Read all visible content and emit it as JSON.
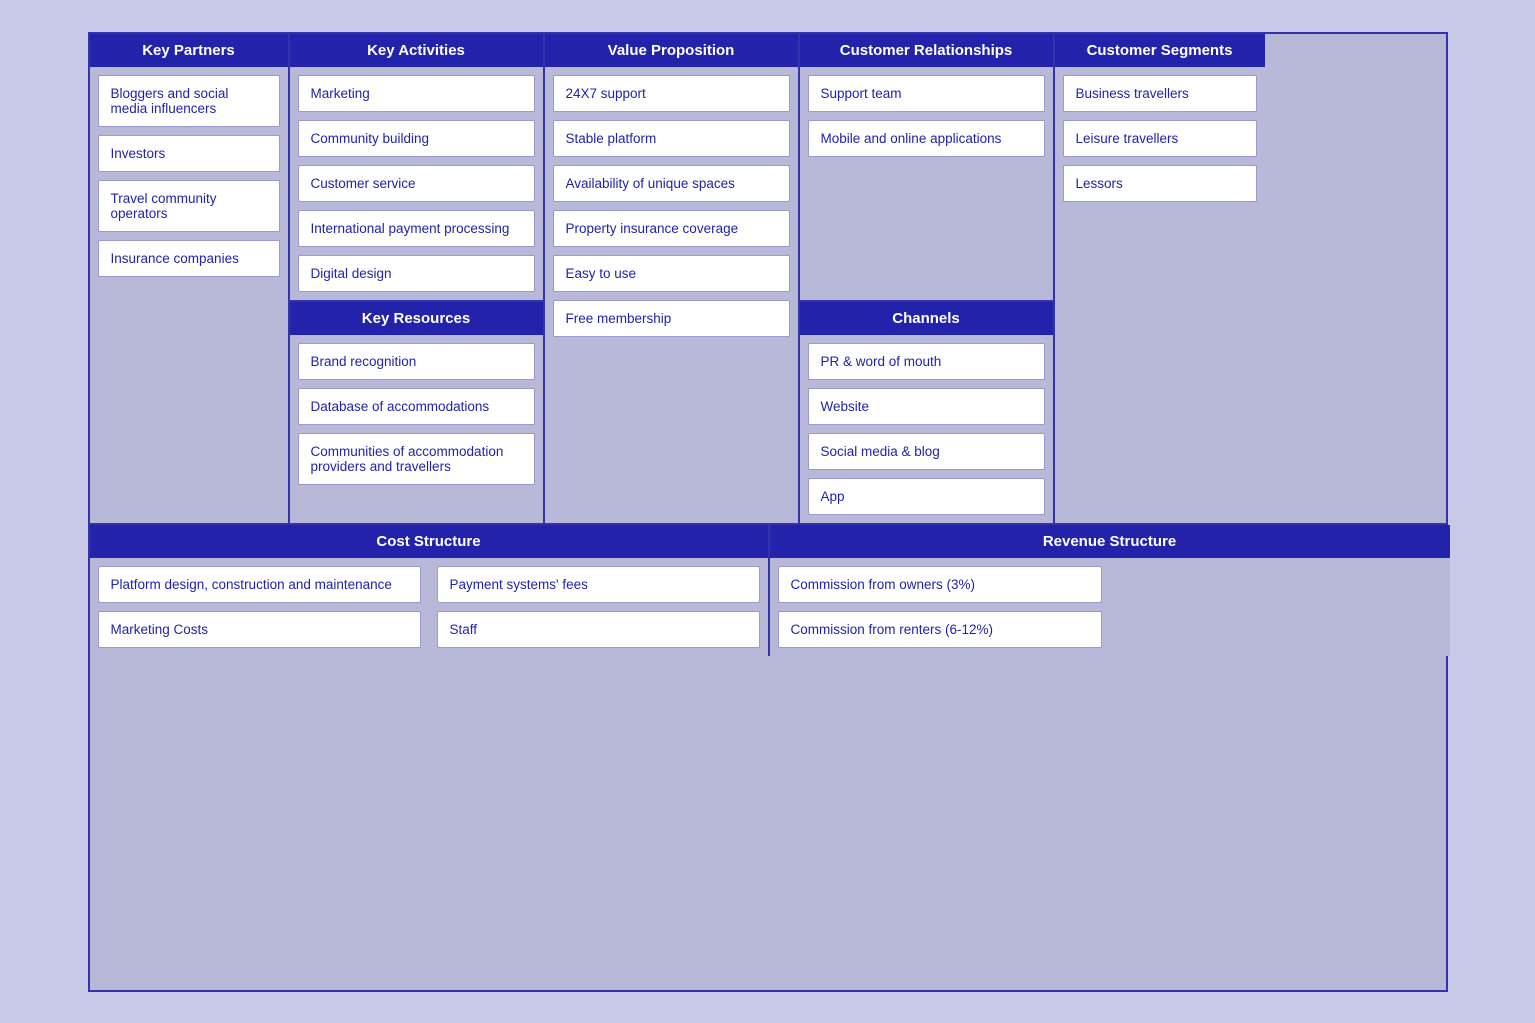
{
  "headers": {
    "key_partners": "Key Partners",
    "key_activities": "Key Activities",
    "value_proposition": "Value Proposition",
    "customer_relationships": "Customer Relationships",
    "customer_segments": "Customer Segments",
    "key_resources": "Key Resources",
    "channels": "Channels",
    "cost_structure": "Cost Structure",
    "revenue_structure": "Revenue Structure"
  },
  "key_partners": {
    "items": [
      "Bloggers and social media influencers",
      "Investors",
      "Travel community operators",
      "Insurance companies"
    ]
  },
  "key_activities": {
    "items": [
      "Marketing",
      "Community building",
      "Customer service",
      "International payment processing",
      "Digital design"
    ]
  },
  "value_proposition": {
    "items": [
      "24X7 support",
      "Stable platform",
      "Availability of unique spaces",
      "Property insurance coverage",
      "Easy to use",
      "Free membership"
    ]
  },
  "customer_relationships": {
    "items": [
      "Support team",
      "Mobile and online applications"
    ]
  },
  "customer_segments": {
    "items": [
      "Business travellers",
      "Leisure travellers",
      "Lessors"
    ]
  },
  "key_resources": {
    "items": [
      "Brand recognition",
      "Database of accommodations",
      "Communities of accommodation providers and travellers"
    ]
  },
  "channels": {
    "items": [
      "PR & word of mouth",
      "Website",
      "Social media & blog",
      "App"
    ]
  },
  "cost_structure": {
    "col1": [
      "Platform design, construction and maintenance",
      "Marketing Costs"
    ],
    "col2": [
      "Payment systems' fees",
      "Staff"
    ]
  },
  "revenue_structure": {
    "col1": [
      "Commission from owners (3%)",
      "Commission from renters (6-12%)"
    ],
    "col2": []
  }
}
